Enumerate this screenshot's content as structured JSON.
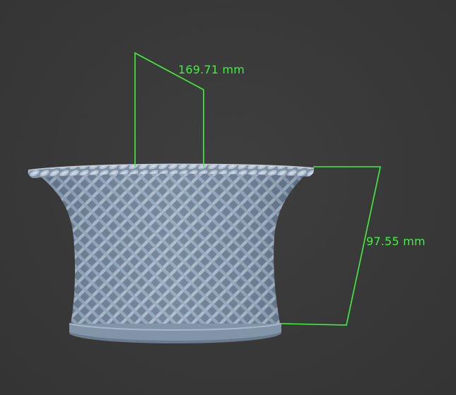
{
  "dimensions": {
    "width_label": "169.71 mm",
    "height_label": "97.55 mm"
  },
  "colors": {
    "background": "#393939",
    "model": "#8a9db3",
    "dimension_line": "#3df23d"
  },
  "model": {
    "name": "woven-basket-vase",
    "object_icon": "woven-basket-model"
  }
}
